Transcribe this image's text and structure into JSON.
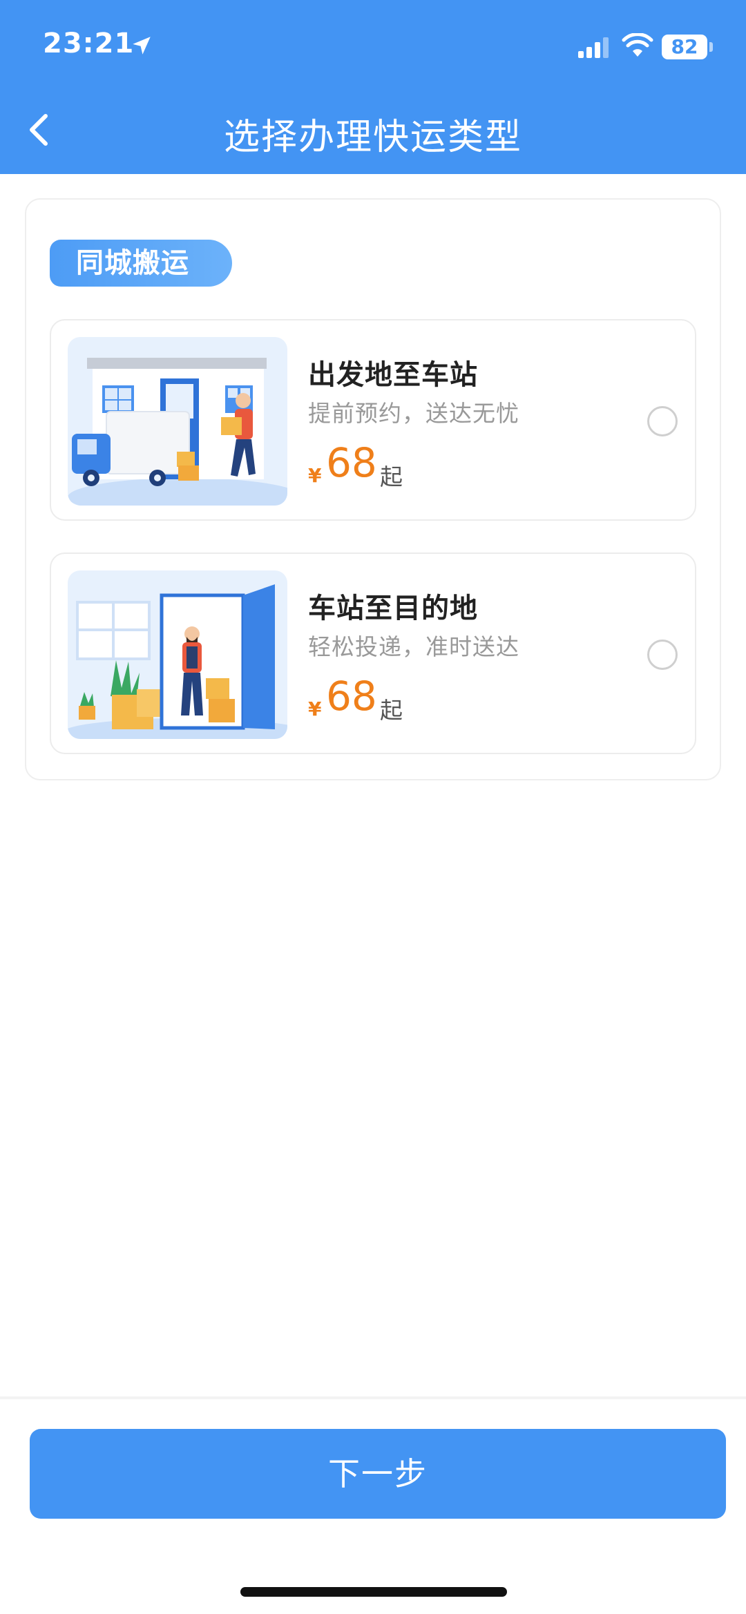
{
  "status_bar": {
    "time": "23:21",
    "battery": "82"
  },
  "header": {
    "title": "选择办理快运类型",
    "back_icon": "chevron-left-icon"
  },
  "section": {
    "tag": "同城搬运"
  },
  "options": [
    {
      "title": "出发地至车站",
      "subtitle": "提前预约，送达无忧",
      "currency": "¥",
      "price": "68",
      "price_suffix": "起",
      "selected": false,
      "illustration": "delivery-truck-illustration"
    },
    {
      "title": "车站至目的地",
      "subtitle": "轻松投递，准时送达",
      "currency": "¥",
      "price": "68",
      "price_suffix": "起",
      "selected": false,
      "illustration": "door-delivery-illustration"
    }
  ],
  "footer": {
    "next_label": "下一步"
  },
  "colors": {
    "primary": "#4394f3",
    "price": "#ef7f1a"
  }
}
